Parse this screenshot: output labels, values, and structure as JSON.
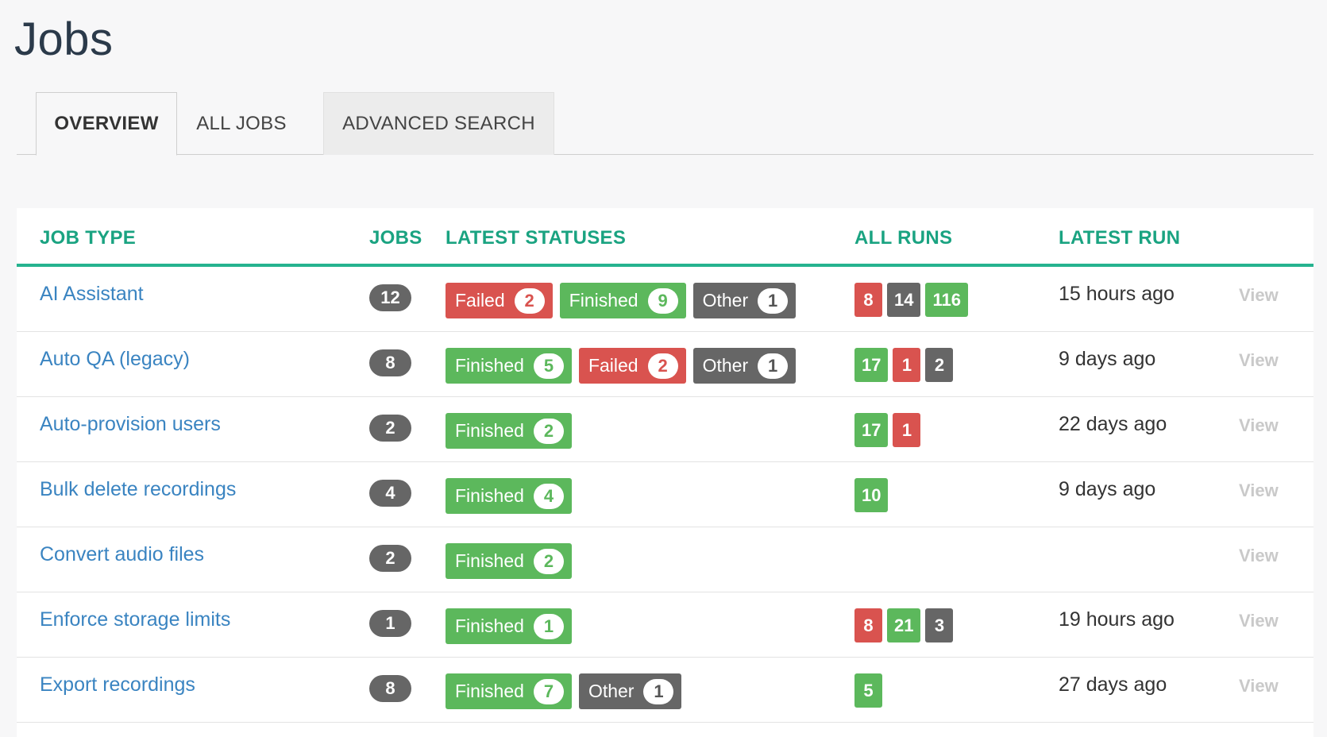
{
  "page": {
    "title": "Jobs"
  },
  "tabs": [
    {
      "label": "OVERVIEW",
      "active": true
    },
    {
      "label": "ALL JOBS",
      "active": false
    },
    {
      "label": "ADVANCED SEARCH",
      "active": false
    }
  ],
  "columns": {
    "job_type": "JOB TYPE",
    "jobs": "JOBS",
    "latest_statuses": "LATEST STATUSES",
    "all_runs": "ALL RUNS",
    "latest_run": "LATEST RUN"
  },
  "colors": {
    "accent": "#1aa381",
    "success": "#5cb85c",
    "danger": "#d9534f",
    "neutral": "#666666",
    "link": "#3a84c1"
  },
  "rows": [
    {
      "job_type": "AI Assistant",
      "jobs": "12",
      "statuses": [
        {
          "label": "Failed",
          "count": "2",
          "color": "red"
        },
        {
          "label": "Finished",
          "count": "9",
          "color": "green"
        },
        {
          "label": "Other",
          "count": "1",
          "color": "gray"
        }
      ],
      "runs": [
        {
          "value": "8",
          "color": "red"
        },
        {
          "value": "14",
          "color": "gray"
        },
        {
          "value": "116",
          "color": "green"
        }
      ],
      "latest_run": "15 hours ago",
      "view": "View"
    },
    {
      "job_type": "Auto QA (legacy)",
      "jobs": "8",
      "statuses": [
        {
          "label": "Finished",
          "count": "5",
          "color": "green"
        },
        {
          "label": "Failed",
          "count": "2",
          "color": "red"
        },
        {
          "label": "Other",
          "count": "1",
          "color": "gray"
        }
      ],
      "runs": [
        {
          "value": "17",
          "color": "green"
        },
        {
          "value": "1",
          "color": "red"
        },
        {
          "value": "2",
          "color": "gray"
        }
      ],
      "latest_run": "9 days ago",
      "view": "View"
    },
    {
      "job_type": "Auto-provision users",
      "jobs": "2",
      "statuses": [
        {
          "label": "Finished",
          "count": "2",
          "color": "green"
        }
      ],
      "runs": [
        {
          "value": "17",
          "color": "green"
        },
        {
          "value": "1",
          "color": "red"
        }
      ],
      "latest_run": "22 days ago",
      "view": "View"
    },
    {
      "job_type": "Bulk delete recordings",
      "jobs": "4",
      "statuses": [
        {
          "label": "Finished",
          "count": "4",
          "color": "green"
        }
      ],
      "runs": [
        {
          "value": "10",
          "color": "green"
        }
      ],
      "latest_run": "9 days ago",
      "view": "View"
    },
    {
      "job_type": "Convert audio files",
      "jobs": "2",
      "statuses": [
        {
          "label": "Finished",
          "count": "2",
          "color": "green"
        }
      ],
      "runs": [],
      "latest_run": "",
      "view": "View"
    },
    {
      "job_type": "Enforce storage limits",
      "jobs": "1",
      "statuses": [
        {
          "label": "Finished",
          "count": "1",
          "color": "green"
        }
      ],
      "runs": [
        {
          "value": "8",
          "color": "red"
        },
        {
          "value": "21",
          "color": "green"
        },
        {
          "value": "3",
          "color": "gray"
        }
      ],
      "latest_run": "19 hours ago",
      "view": "View"
    },
    {
      "job_type": "Export recordings",
      "jobs": "8",
      "statuses": [
        {
          "label": "Finished",
          "count": "7",
          "color": "green"
        },
        {
          "label": "Other",
          "count": "1",
          "color": "gray"
        }
      ],
      "runs": [
        {
          "value": "5",
          "color": "green"
        }
      ],
      "latest_run": "27 days ago",
      "view": "View"
    }
  ]
}
